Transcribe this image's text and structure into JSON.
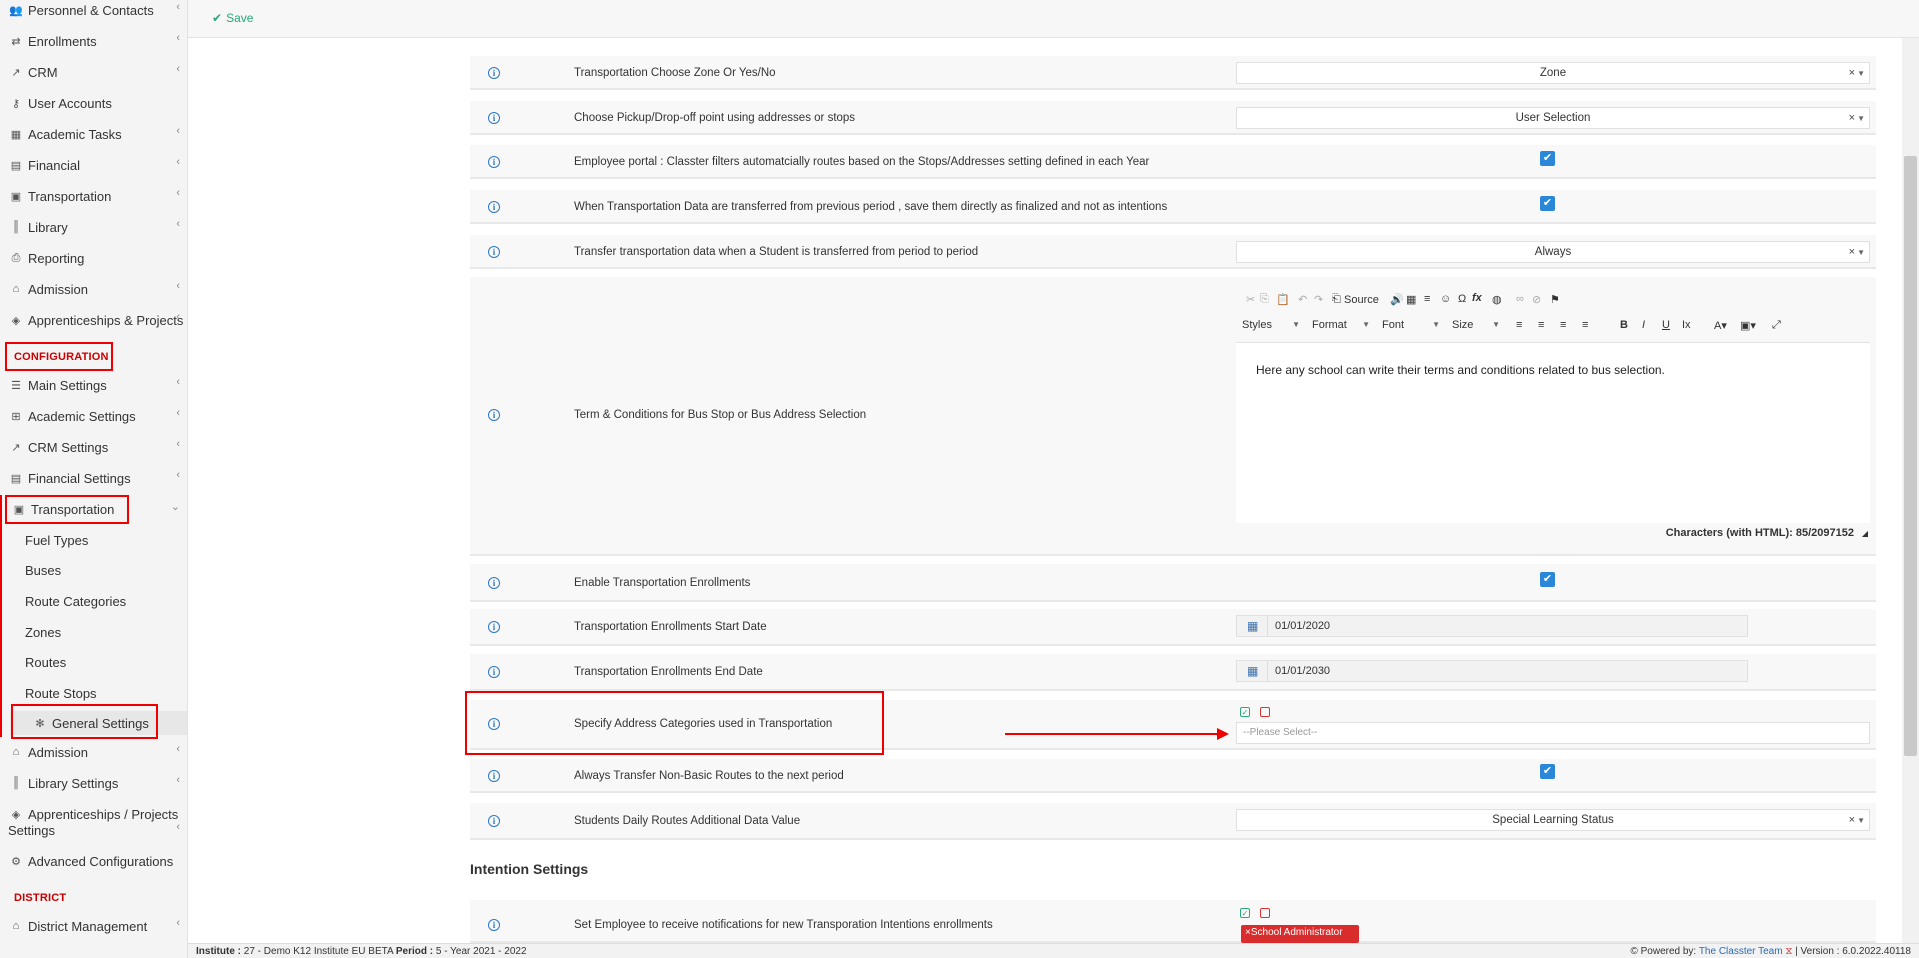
{
  "sidebar": {
    "items": [
      {
        "label": "Personnel & Contacts",
        "icon": "people-icon",
        "chev": true
      },
      {
        "label": "Enrollments",
        "icon": "arrows-icon",
        "chev": true
      },
      {
        "label": "CRM",
        "icon": "chart-line-icon",
        "chev": true
      },
      {
        "label": "User Accounts",
        "icon": "key-icon",
        "chev": false
      },
      {
        "label": "Academic Tasks",
        "icon": "grid-icon",
        "chev": true
      },
      {
        "label": "Financial",
        "icon": "money-icon",
        "chev": true
      },
      {
        "label": "Transportation",
        "icon": "bus-icon",
        "chev": true
      },
      {
        "label": "Library",
        "icon": "books-icon",
        "chev": true
      },
      {
        "label": "Reporting",
        "icon": "printer-icon",
        "chev": false
      },
      {
        "label": "Admission",
        "icon": "building-icon",
        "chev": true
      },
      {
        "label": "Apprenticeships & Projects",
        "icon": "cube-icon",
        "chev": true
      }
    ],
    "config_section": "CONFIGURATION",
    "config_items": [
      {
        "label": "Main Settings",
        "icon": "sliders-icon",
        "chev": true
      },
      {
        "label": "Academic Settings",
        "icon": "org-chart-icon",
        "chev": true
      },
      {
        "label": "CRM Settings",
        "icon": "chart-line-icon",
        "chev": true
      },
      {
        "label": "Financial Settings",
        "icon": "money-icon",
        "chev": true
      },
      {
        "label": "Transportation",
        "icon": "bus-icon",
        "chev": true
      }
    ],
    "transport_sub": [
      "Fuel Types",
      "Buses",
      "Route Categories",
      "Zones",
      "Routes",
      "Route Stops",
      "General Settings"
    ],
    "after_items": [
      {
        "label": "Admission",
        "icon": "building-icon",
        "chev": true
      },
      {
        "label": "Library Settings",
        "icon": "books-icon",
        "chev": true
      },
      {
        "label": "Apprenticeships / Projects",
        "label2": "Settings",
        "icon": "cube-icon",
        "chev": true
      },
      {
        "label": "Advanced Configurations",
        "icon": "gears-icon",
        "chev": false
      }
    ],
    "district_section": "DISTRICT",
    "district_items": [
      {
        "label": "District Management",
        "icon": "building-icon",
        "chev": true
      }
    ]
  },
  "toolbar": {
    "save_label": "Save"
  },
  "settings": {
    "zone_label": "Transportation Choose Zone Or Yes/No",
    "zone_value": "Zone",
    "pickup_label": "Choose Pickup/Drop-off point using addresses or stops",
    "pickup_value": "User Selection",
    "employee_portal_label": "Employee portal : Classter filters automatcially routes based on the Stops/Addresses setting defined in each Year",
    "transfer_prev_label": "When Transportation Data are transferred from previous period , save them directly as finalized and not as intentions",
    "transfer_student_label": "Transfer transportation data when a Student is transferred from period to period",
    "transfer_student_value": "Always",
    "terms_label": "Term & Conditions for Bus Stop or Bus Address Selection",
    "enable_enroll_label": "Enable Transportation Enrollments",
    "start_date_label": "Transportation Enrollments Start Date",
    "start_date_value": "01/01/2020",
    "end_date_label": "Transportation Enrollments End Date",
    "end_date_value": "01/01/2030",
    "address_cat_label": "Specify Address Categories used in Transportation",
    "address_cat_placeholder": "--Please Select--",
    "non_basic_label": "Always Transfer Non-Basic Routes to the next period",
    "daily_routes_label": "Students Daily Routes Additional Data Value",
    "daily_routes_value": "Special Learning Status"
  },
  "editor": {
    "source_label": "Source",
    "styles_label": "Styles",
    "format_label": "Format",
    "font_label": "Font",
    "size_label": "Size",
    "body_text": "Here any school can write their terms and conditions related to bus selection.",
    "char_count": "Characters (with HTML): 85/2097152"
  },
  "intention": {
    "section_title": "Intention Settings",
    "notify_label": "Set Employee to receive notifications for new Transporation Intentions enrollments",
    "admin_tag": "×School Administrator"
  },
  "footer": {
    "institute_key": "Institute :",
    "institute_value": "27 - Demo K12 Institute EU BETA",
    "period_key": "Period :",
    "period_value": "5 - Year 2021 - 2022",
    "powered_by": "Powered by:",
    "team": "The Classter Team",
    "version": "| Version : 6.0.2022.40118"
  },
  "colors": {
    "accent_red": "#e00000",
    "checkbox_blue": "#2b88d8",
    "save_green": "#2aa87a",
    "link_blue": "#2b6cb0"
  }
}
